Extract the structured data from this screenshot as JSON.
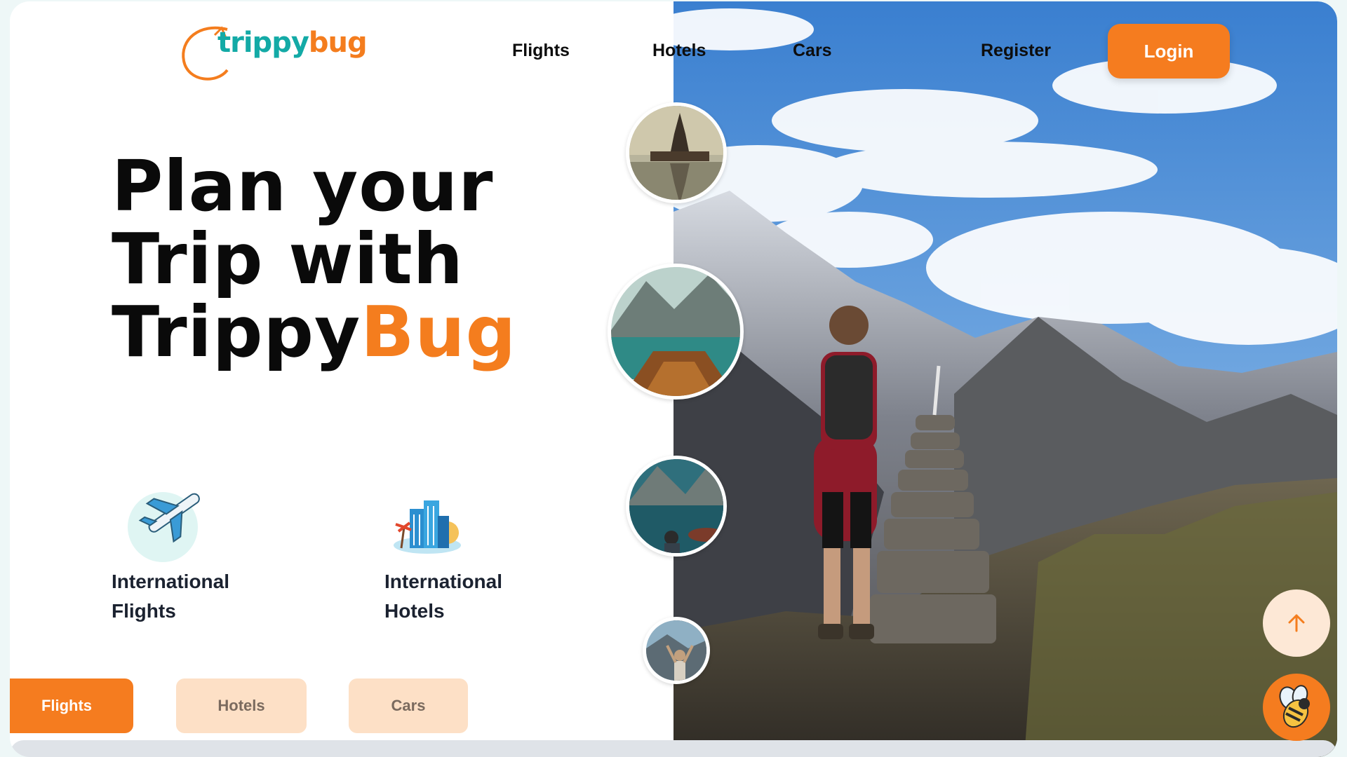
{
  "brand": {
    "part1": "trippy",
    "part2": "bug",
    "orange": "#f47d1e",
    "teal": "#13aaa6"
  },
  "nav": {
    "flights": "Flights",
    "hotels": "Hotels",
    "cars": "Cars",
    "register": "Register",
    "login": "Login"
  },
  "hero": {
    "line1": "Plan your",
    "line2": "Trip with",
    "line3_a": "Trippy",
    "line3_b": "Bug"
  },
  "features": [
    {
      "label_l1": "International",
      "label_l2": "Flights",
      "icon": "airplane-icon"
    },
    {
      "label_l1": "International",
      "label_l2": "Hotels",
      "icon": "hotel-buildings-icon"
    }
  ],
  "tabs": {
    "flights": "Flights",
    "hotels": "Hotels",
    "cars": "Cars",
    "active": "Flights"
  },
  "thumbnails": [
    "pagoda-lake",
    "boat-mountain-lake",
    "boats-lake",
    "person-arms-raised"
  ],
  "floating": {
    "scroll_top_icon": "arrow-up-icon",
    "chat_icon": "bee-mascot-icon"
  }
}
